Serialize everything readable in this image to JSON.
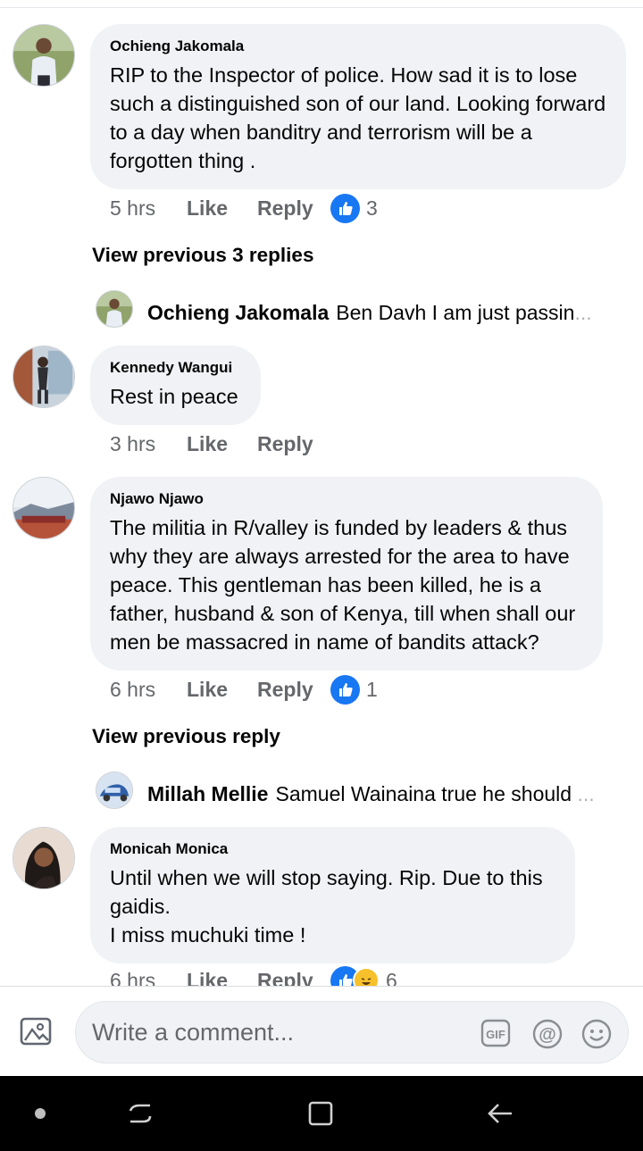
{
  "comments": [
    {
      "author": "Ochieng Jakomala",
      "text": "RIP to  the Inspector of police. How sad it is to lose such a distinguished son of our land. Looking forward to a day when banditry and terrorism will be a forgotten thing .",
      "time": "5 hrs",
      "like_label": "Like",
      "reply_label": "Reply",
      "reaction_count": "3",
      "view_previous": "View previous 3 replies",
      "reply_preview": {
        "author": "Ochieng Jakomala",
        "text": "Ben Davh I am just passin",
        "ellipsis": "..."
      }
    },
    {
      "author": "Kennedy Wangui",
      "text": "Rest in peace",
      "time": "3 hrs",
      "like_label": "Like",
      "reply_label": "Reply"
    },
    {
      "author": "Njawo Njawo",
      "text": "The militia in R/valley is funded by leaders & thus why they are always arrested for the area to have peace. This gentleman has been killed, he is a father, husband & son of Kenya, till when shall our men be massacred in name of bandits attack?",
      "time": "6 hrs",
      "like_label": "Like",
      "reply_label": "Reply",
      "reaction_count": "1",
      "view_previous": "View previous reply",
      "reply_preview": {
        "author": "Millah Mellie",
        "text": "Samuel Wainaina true he should",
        "ellipsis": " ..."
      }
    },
    {
      "author": "Monicah Monica",
      "text": "Until when we will stop saying. Rip. Due to this gaidis.\nI miss muchuki time !",
      "time": "6 hrs",
      "like_label": "Like",
      "reply_label": "Reply",
      "reaction_count": "6"
    }
  ],
  "composer": {
    "placeholder": "Write a comment...",
    "icons": [
      "photo-icon",
      "gif-icon",
      "mention-icon",
      "emoji-icon"
    ]
  },
  "navbar": {
    "icons": [
      "dot-icon",
      "recent-apps-icon",
      "home-icon",
      "back-icon"
    ]
  },
  "colors": {
    "bubble": "#f0f2f5",
    "link": "#1877f2",
    "meta_text": "#65676b"
  }
}
